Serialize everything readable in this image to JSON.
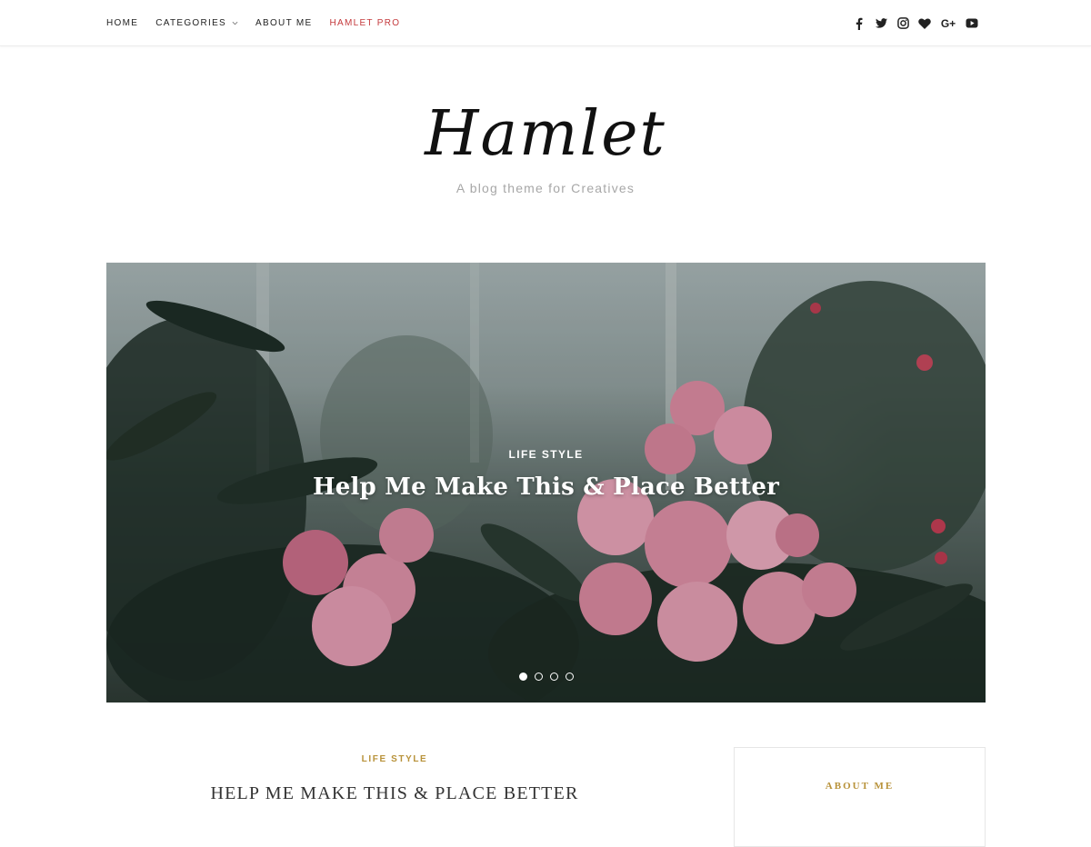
{
  "nav": {
    "items": [
      {
        "label": "HOME"
      },
      {
        "label": "CATEGORIES"
      },
      {
        "label": "ABOUT ME"
      },
      {
        "label": "HAMLET PRO"
      }
    ]
  },
  "social": {
    "icons": [
      "facebook-icon",
      "twitter-icon",
      "instagram-icon",
      "heart-icon",
      "google-plus-icon",
      "youtube-icon"
    ],
    "google_plus_label": "G+"
  },
  "header": {
    "brand": "Hamlet",
    "tagline": "A blog theme for Creatives"
  },
  "slider": {
    "category": "LIFE STYLE",
    "title": "Help Me Make This & Place Better",
    "slide_count": 4,
    "active_slide": 1
  },
  "post": {
    "category": "LIFE STYLE",
    "title": "HELP ME MAKE THIS & PLACE BETTER"
  },
  "sidebar": {
    "widget_title": "ABOUT ME"
  },
  "colors": {
    "accent_gold": "#b8923a",
    "pro_red": "#c4393c",
    "tagline_gray": "#a7a7a7"
  }
}
